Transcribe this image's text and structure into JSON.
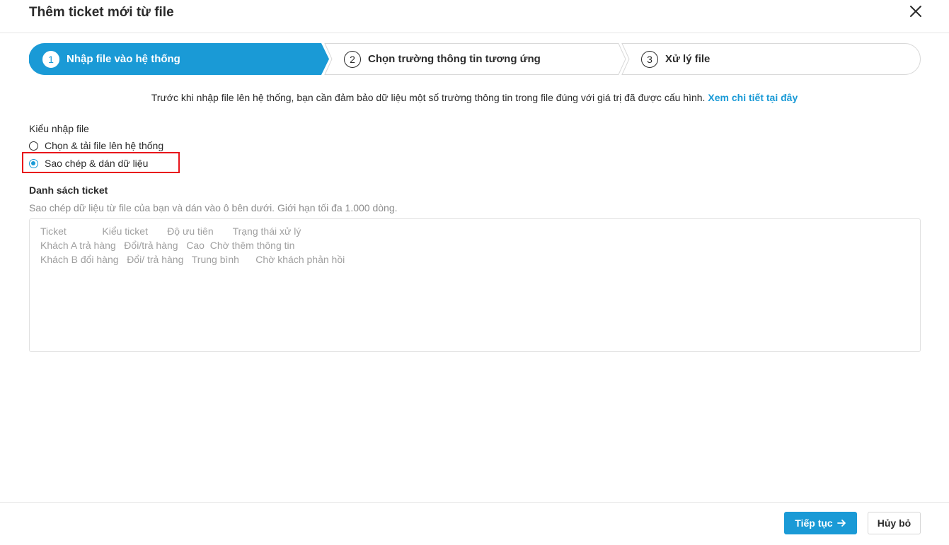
{
  "dialog": {
    "title": "Thêm ticket mới từ file",
    "close_icon": "close-icon"
  },
  "stepper": {
    "steps": [
      {
        "number": "1",
        "label": "Nhập file vào hệ thống",
        "active": true
      },
      {
        "number": "2",
        "label": "Chọn trường thông tin tương ứng",
        "active": false
      },
      {
        "number": "3",
        "label": "Xử lý file",
        "active": false
      }
    ],
    "active_color": "#1a9ad6"
  },
  "notice": {
    "text": "Trước khi nhập file lên hệ thống, bạn cần đảm bảo dữ liệu một số trường thông tin trong file đúng với giá trị đã được cấu hình.",
    "link_text": "Xem chi tiết tại đây"
  },
  "import_type": {
    "label": "Kiểu nhập file",
    "options": [
      {
        "label": "Chọn & tải file lên hệ thống",
        "selected": false
      },
      {
        "label": "Sao chép & dán dữ liệu",
        "selected": true
      }
    ]
  },
  "ticket_list": {
    "title": "Danh sách ticket",
    "hint": "Sao chép dữ liệu từ file của bạn và dán vào ô bên dưới. Giới hạn tối đa 1.000 dòng.",
    "placeholder_lines": [
      "Ticket             Kiểu ticket       Độ ưu tiên       Trạng thái xử lý",
      "Khách A trả hàng   Đổi/trả hàng   Cao  Chờ thêm thông tin",
      "Khách B đổi hàng   Đổi/ trả hàng   Trung bình      Chờ khách phản hồi"
    ]
  },
  "footer": {
    "next_label": "Tiếp tục",
    "next_icon": "arrow-right-icon",
    "cancel_label": "Hủy bỏ"
  },
  "colors": {
    "accent": "#1a9ad6",
    "highlight_border": "#e8141b"
  }
}
